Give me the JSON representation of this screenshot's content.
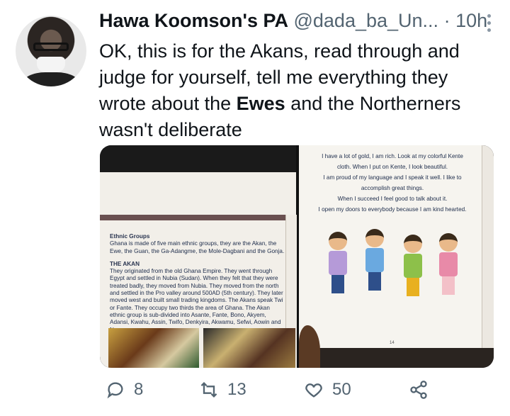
{
  "author": {
    "name": "Hawa Koomson's PA",
    "handle": "@dada_ba_Un...",
    "separator": "·",
    "time": "10h"
  },
  "tweet": {
    "text_before": "OK, this is for the Akans, read through and judge for yourself, tell me everything they wrote about the ",
    "text_bold": "Ewes",
    "text_after": " and the Northerners wasn't deliberate"
  },
  "book_left": {
    "heading": "Ethnic Groups",
    "intro": "Ghana is made of five main ethnic groups, they are the Akan, the Ewe, the Guan, the Ga-Adangme, the Mole-Dagbani and the Gonja.",
    "subheading": "THE AKAN",
    "body": "They originated from the old Ghana Empire. They went through Egypt and settled in Nubia (Sudan). When they felt that they were treated badly, they moved from Nubia. They moved from the north and settled in the Pro valley around 500AD (5th century). They later moved west and built small trading kingdoms. The Akans speak Twi or Fante. They occupy two thirds the area of Ghana. The Akan ethnic group is sub-divided into Asante, Fante, Bono, Akyem, Adansi, Kwahu, Assin, Twifo, Denkyira, Akwamu, Sefwi, Aowin and Nzema."
  },
  "book_right": {
    "lines": [
      "I have a lot of gold, I am rich. Look at my colorful Kente",
      "cloth. When I put on Kente, I look beautiful.",
      "I am proud of my language and I speak it well. I like to",
      "accomplish great things.",
      "When I succeed I feel good to talk about it.",
      "I open my doors to everybody because I am kind hearted."
    ],
    "page_number": "14"
  },
  "actions": {
    "reply_count": "8",
    "retweet_count": "13",
    "like_count": "50"
  },
  "icons": {
    "reply": "reply-icon",
    "retweet": "retweet-icon",
    "like": "heart-icon",
    "share": "share-icon",
    "more": "more-icon"
  }
}
